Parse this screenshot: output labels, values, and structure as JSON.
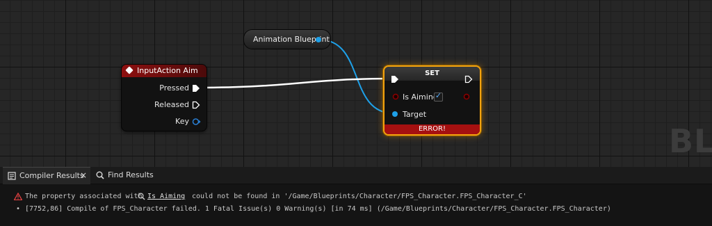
{
  "graph": {
    "watermark": "BLU",
    "nodes": {
      "animation_blueprint": {
        "label": "Animation Blueprint"
      },
      "input_action": {
        "title": "InputAction Aim",
        "pins": {
          "pressed": "Pressed",
          "released": "Released",
          "key": "Key"
        }
      },
      "set": {
        "title": "SET",
        "pins": {
          "is_aiming": "Is Aiming",
          "target": "Target"
        },
        "is_aiming_checked": true,
        "error": "ERROR!"
      }
    },
    "colors": {
      "exec": "#ffffff",
      "object": "#1ea0e8",
      "bool": "#8c0000",
      "error": "#a51010",
      "selection": "#f2a20f"
    }
  },
  "panel": {
    "tabs": [
      {
        "label": "Compiler Results",
        "icon": "compiler-results-icon",
        "active": true
      },
      {
        "label": "Find Results",
        "icon": "search-icon",
        "active": false
      }
    ],
    "close_glyph": "×",
    "messages": {
      "error": {
        "prefix": "The property associated with",
        "link": "Is Aiming",
        "suffix": "could not be found in '/Game/Blueprints/Character/FPS_Character.FPS_Character_C'"
      },
      "info": "[7752,86] Compile of FPS_Character failed. 1 Fatal Issue(s) 0 Warning(s) [in 74 ms] (/Game/Blueprints/Character/FPS_Character.FPS_Character)"
    }
  }
}
